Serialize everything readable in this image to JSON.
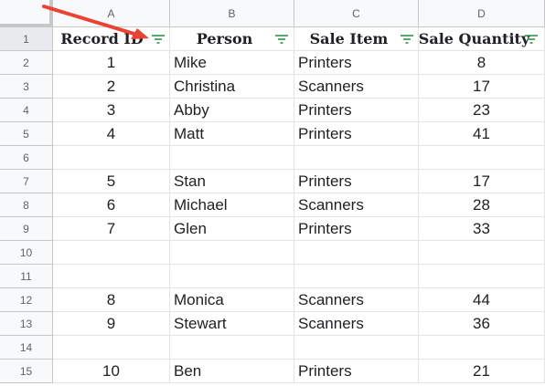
{
  "columns": [
    {
      "letter": "A",
      "header": "Record ID"
    },
    {
      "letter": "B",
      "header": "Person"
    },
    {
      "letter": "C",
      "header": "Sale Item"
    },
    {
      "letter": "D",
      "header": "Sale Quantity"
    }
  ],
  "row_numbers": [
    "1",
    "2",
    "3",
    "4",
    "5",
    "6",
    "7",
    "8",
    "9",
    "10",
    "11",
    "12",
    "13",
    "14",
    "15"
  ],
  "rows": [
    [
      "1",
      "Mike",
      "Printers",
      "8"
    ],
    [
      "2",
      "Christina",
      "Scanners",
      "17"
    ],
    [
      "3",
      "Abby",
      "Printers",
      "23"
    ],
    [
      "4",
      "Matt",
      "Printers",
      "41"
    ],
    [
      "",
      "",
      "",
      ""
    ],
    [
      "5",
      "Stan",
      "Printers",
      "17"
    ],
    [
      "6",
      "Michael",
      "Scanners",
      "28"
    ],
    [
      "7",
      "Glen",
      "Printers",
      "33"
    ],
    [
      "",
      "",
      "",
      ""
    ],
    [
      "",
      "",
      "",
      ""
    ],
    [
      "8",
      "Monica",
      "Scanners",
      "44"
    ],
    [
      "9",
      "Stewart",
      "Scanners",
      "36"
    ],
    [
      "",
      "",
      "",
      ""
    ],
    [
      "10",
      "Ben",
      "Printers",
      "21"
    ]
  ],
  "icons": {
    "filter": "filter-icon",
    "annotation": "arrow-annotation"
  },
  "colors": {
    "filter_icon": "#1e8e3e",
    "arrow": "#ea4335",
    "header_bg": "#f8f9fa"
  }
}
